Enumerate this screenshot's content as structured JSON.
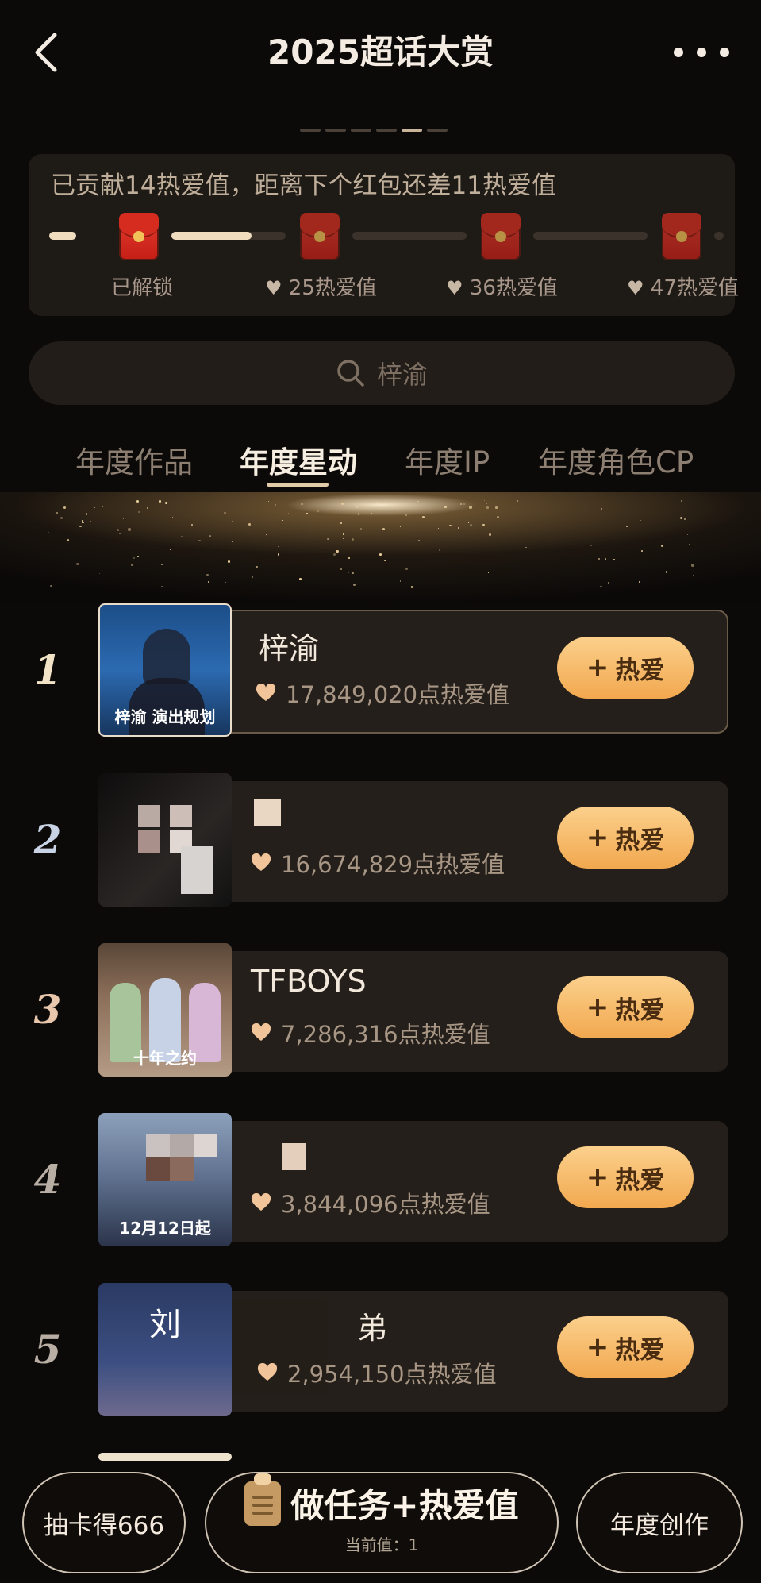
{
  "header": {
    "title": "2025超话大赏"
  },
  "progress": {
    "text": "已贡献14热爱值，距离下个红包还差11热爱值",
    "unlocked_label": "已解锁",
    "milestones": [
      {
        "label": "25热爱值"
      },
      {
        "label": "36热爱值"
      },
      {
        "label": "47热爱值"
      }
    ],
    "first_segment_fill": 0.7
  },
  "search": {
    "placeholder": "梓渝"
  },
  "tabs": [
    {
      "label": "年度作品",
      "active": false
    },
    {
      "label": "年度星动",
      "active": true
    },
    {
      "label": "年度IP",
      "active": false
    },
    {
      "label": "年度角色CP",
      "active": false
    }
  ],
  "ranking": [
    {
      "rank": "1",
      "name": "梓渝",
      "score": "17,849,020点热爱值",
      "button": "热爱",
      "thumb_caption": "梓渝 演出规划"
    },
    {
      "rank": "2",
      "name": "",
      "score": "16,674,829点热爱值",
      "button": "热爱",
      "thumb_caption": ""
    },
    {
      "rank": "3",
      "name": "TFBOYS",
      "score": "7,286,316点热爱值",
      "button": "热爱",
      "thumb_caption": "十年之约"
    },
    {
      "rank": "4",
      "name": "",
      "score": "3,844,096点热爱值",
      "button": "热爱",
      "thumb_caption": "12月12日起"
    },
    {
      "rank": "5",
      "name": "弟",
      "score": "2,954,150点热爱值",
      "button": "热爱",
      "thumb_caption": "刘"
    }
  ],
  "bottom": {
    "left_button": "抽卡得666",
    "center_main": "做任务+热爱值",
    "center_sub": "当前值：1",
    "right_button": "年度创作"
  },
  "colors": {
    "accent_gold": "#f2a84f",
    "background": "#0c0a08",
    "card": "#241f1a"
  }
}
